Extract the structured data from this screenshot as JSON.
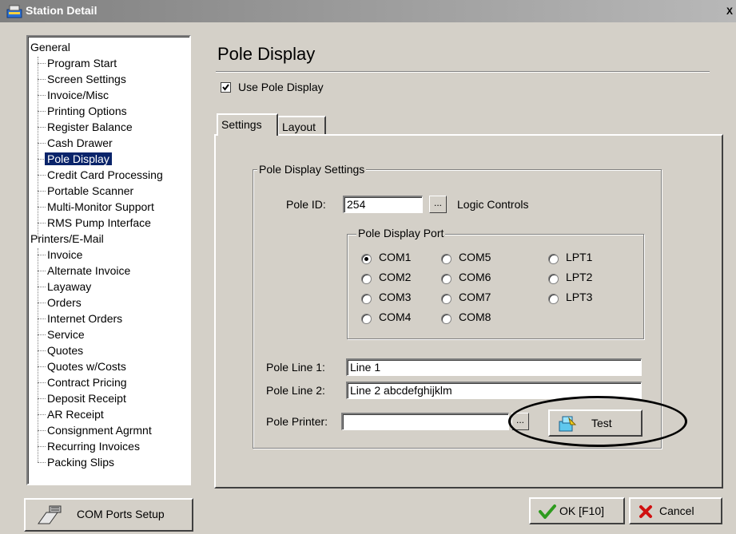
{
  "window": {
    "title": "Station Detail",
    "close_label": "X"
  },
  "tree": {
    "items": [
      {
        "label": "General",
        "level": 0
      },
      {
        "label": "Program Start",
        "level": 1
      },
      {
        "label": "Screen Settings",
        "level": 1
      },
      {
        "label": "Invoice/Misc",
        "level": 1
      },
      {
        "label": "Printing Options",
        "level": 1
      },
      {
        "label": "Register Balance",
        "level": 1
      },
      {
        "label": "Cash Drawer",
        "level": 1
      },
      {
        "label": "Pole Display",
        "level": 1,
        "selected": true
      },
      {
        "label": "Credit Card Processing",
        "level": 1
      },
      {
        "label": "Portable Scanner",
        "level": 1
      },
      {
        "label": "Multi-Monitor Support",
        "level": 1
      },
      {
        "label": "RMS Pump Interface",
        "level": 1
      },
      {
        "label": "Printers/E-Mail",
        "level": 0
      },
      {
        "label": "Invoice",
        "level": 1
      },
      {
        "label": "Alternate Invoice",
        "level": 1
      },
      {
        "label": "Layaway",
        "level": 1
      },
      {
        "label": "Orders",
        "level": 1
      },
      {
        "label": "Internet Orders",
        "level": 1
      },
      {
        "label": "Service",
        "level": 1
      },
      {
        "label": "Quotes",
        "level": 1
      },
      {
        "label": "Quotes w/Costs",
        "level": 1
      },
      {
        "label": "Contract Pricing",
        "level": 1
      },
      {
        "label": "Deposit Receipt",
        "level": 1
      },
      {
        "label": "AR Receipt",
        "level": 1
      },
      {
        "label": "Consignment Agrmnt",
        "level": 1
      },
      {
        "label": "Recurring Invoices",
        "level": 1
      },
      {
        "label": "Packing Slips",
        "level": 1
      }
    ]
  },
  "com_ports_button": {
    "label": "COM Ports Setup"
  },
  "page": {
    "title": "Pole Display"
  },
  "use_pole_display": {
    "label": "Use Pole Display",
    "checked": true
  },
  "tabs": [
    {
      "label": "Settings",
      "active": true
    },
    {
      "label": "Layout",
      "active": false
    }
  ],
  "settings": {
    "group_title": "Pole Display Settings",
    "pole_id_label": "Pole ID:",
    "pole_id_value": "254",
    "browse_label": "...",
    "pole_model": "Logic Controls",
    "port_group_title": "Pole Display Port",
    "ports": [
      {
        "label": "COM1",
        "selected": true
      },
      {
        "label": "COM2",
        "selected": false
      },
      {
        "label": "COM3",
        "selected": false
      },
      {
        "label": "COM4",
        "selected": false
      },
      {
        "label": "COM5",
        "selected": false
      },
      {
        "label": "COM6",
        "selected": false
      },
      {
        "label": "COM7",
        "selected": false
      },
      {
        "label": "COM8",
        "selected": false
      },
      {
        "label": "LPT1",
        "selected": false
      },
      {
        "label": "LPT2",
        "selected": false
      },
      {
        "label": "LPT3",
        "selected": false
      }
    ],
    "line1_label": "Pole Line 1:",
    "line1_value": "Line 1",
    "line2_label": "Pole Line 2:",
    "line2_value": "Line 2 abcdefghijklm",
    "printer_label": "Pole Printer:",
    "printer_value": "",
    "test_label": "Test"
  },
  "footer": {
    "ok_label": "OK [F10]",
    "cancel_label": "Cancel"
  },
  "colors": {
    "face": "#d4d0c8",
    "selection": "#0a246a",
    "ok_check": "#2e9b1e",
    "cancel_x": "#d01010"
  }
}
